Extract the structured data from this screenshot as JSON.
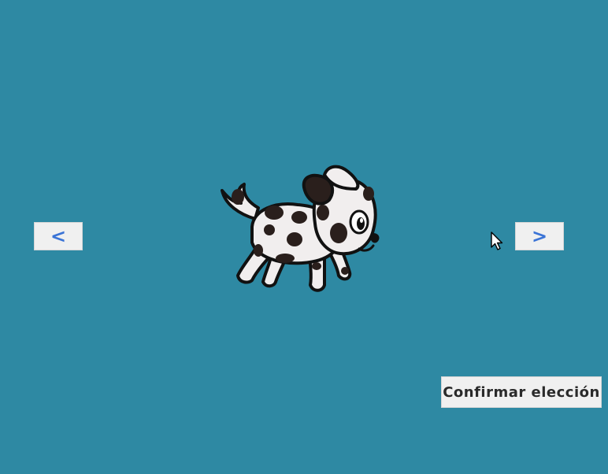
{
  "controls": {
    "prev_label": "<",
    "next_label": ">",
    "confirm_label": "Confirmar elección"
  },
  "character": {
    "icon": "dalmatian-puppy-icon"
  },
  "colors": {
    "background": "#2e89a3",
    "button_bg": "#f0f0f0",
    "arrow": "#3b74d6",
    "confirm_text": "#2a2a2a"
  }
}
